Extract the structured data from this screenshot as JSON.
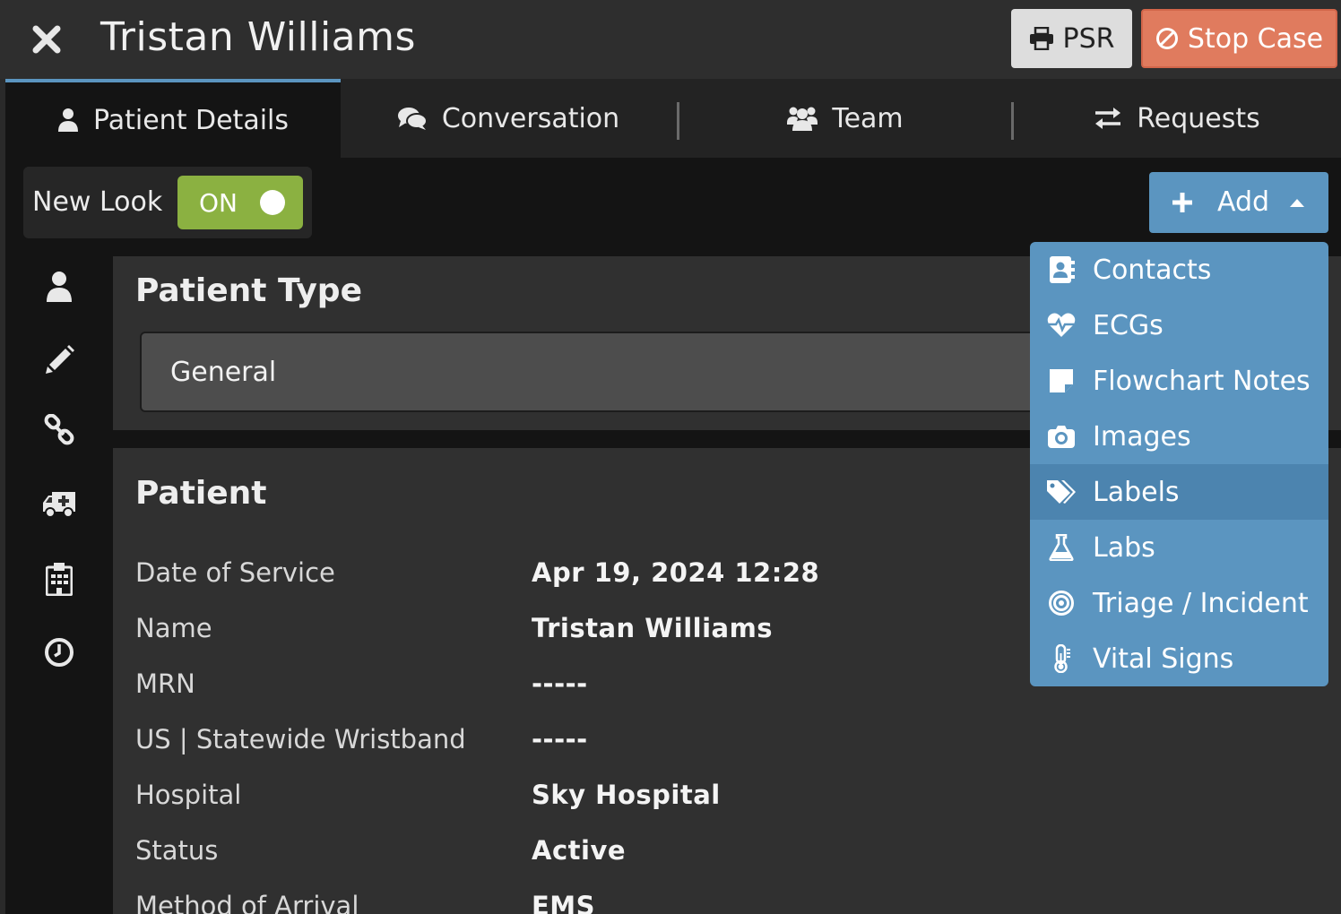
{
  "header": {
    "title": "Tristan Williams",
    "psr_label": "PSR",
    "stop_label": "Stop Case"
  },
  "tabs": [
    {
      "label": "Patient Details",
      "icon": "user-icon",
      "active": true
    },
    {
      "label": "Conversation",
      "icon": "comments-icon",
      "active": false
    },
    {
      "label": "Team",
      "icon": "users-icon",
      "active": false
    },
    {
      "label": "Requests",
      "icon": "exchange-icon",
      "active": false
    }
  ],
  "new_look": {
    "label": "New Look",
    "toggle_label": "ON",
    "enabled": true
  },
  "add_button": {
    "label": "Add"
  },
  "dropdown": {
    "items": [
      {
        "label": "Contacts",
        "icon": "address-book-icon"
      },
      {
        "label": "ECGs",
        "icon": "heartbeat-icon"
      },
      {
        "label": "Flowchart Notes",
        "icon": "sticky-note-icon"
      },
      {
        "label": "Images",
        "icon": "camera-icon"
      },
      {
        "label": "Labels",
        "icon": "tags-icon",
        "highlighted": true
      },
      {
        "label": "Labs",
        "icon": "flask-icon"
      },
      {
        "label": "Triage / Incident",
        "icon": "bullseye-icon"
      },
      {
        "label": "Vital Signs",
        "icon": "thermometer-icon"
      }
    ]
  },
  "rail": [
    "user-icon",
    "pencil-icon",
    "link-icon",
    "ambulance-icon",
    "hospital-icon",
    "clock-icon"
  ],
  "patient_type": {
    "title": "Patient Type",
    "value": "General"
  },
  "patient": {
    "title": "Patient",
    "fields": [
      {
        "label": "Date of Service",
        "value": "Apr 19, 2024 12:28"
      },
      {
        "label": "Name",
        "value": "Tristan Williams"
      },
      {
        "label": "MRN",
        "value": "-----"
      },
      {
        "label": "US | Statewide Wristband",
        "value": "-----"
      },
      {
        "label": "Hospital",
        "value": "Sky Hospital"
      },
      {
        "label": "Status",
        "value": "Active"
      },
      {
        "label": "Method of Arrival",
        "value": "EMS"
      }
    ]
  },
  "colors": {
    "accent": "#5b95c0",
    "stop": "#e07b5e",
    "toggle_on": "#8bb141"
  }
}
